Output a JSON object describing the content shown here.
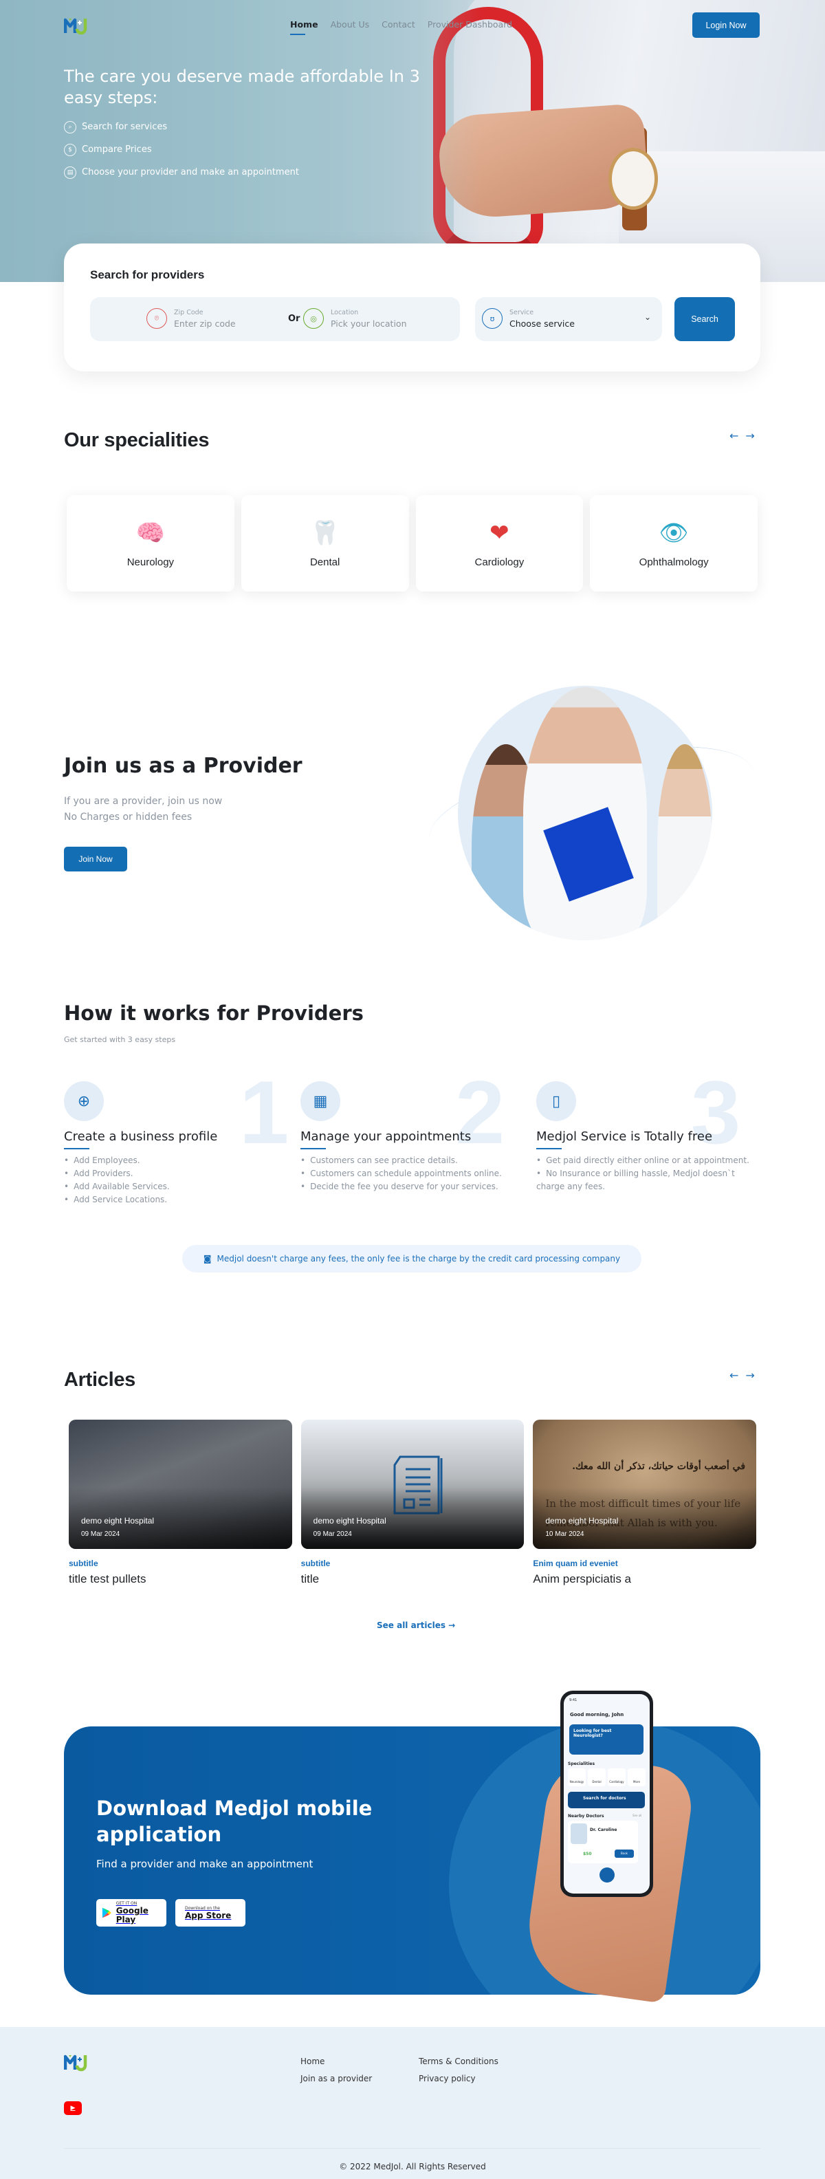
{
  "brand": {
    "logo_text": "M+J",
    "logo_alt": "MedJol logo",
    "accent_color": "#146eb4",
    "logo_blue": "#1a6fba",
    "logo_green": "#8cc63f"
  },
  "nav": {
    "items": [
      {
        "label": "Home",
        "active": true
      },
      {
        "label": "About Us",
        "active": false
      },
      {
        "label": "Contact",
        "active": false
      },
      {
        "label": "Provider Dashboard",
        "active": false
      }
    ],
    "login_label": "Login Now"
  },
  "hero": {
    "title": "The care you deserve made affordable In 3 easy steps:",
    "steps": [
      {
        "icon": "search-icon",
        "label": "Search for services"
      },
      {
        "icon": "dollar-icon",
        "label": "Compare Prices"
      },
      {
        "icon": "calendar-icon",
        "label": "Choose your provider and make an appointment"
      }
    ]
  },
  "search": {
    "title": "Search for providers",
    "zip": {
      "label": "Zip Code",
      "placeholder": "Enter zip code"
    },
    "or_label": "Or",
    "location": {
      "label": "Location",
      "placeholder": "Pick your location"
    },
    "service": {
      "label": "Service",
      "selected": "Choose service"
    },
    "button_label": "Search"
  },
  "specialities": {
    "title": "Our specialities",
    "items": [
      {
        "name": "Neurology",
        "icon": "brain-icon",
        "glyph": "🧠"
      },
      {
        "name": "Dental",
        "icon": "tooth-icon",
        "glyph": "🦷"
      },
      {
        "name": "Cardiology",
        "icon": "heart-organ-icon",
        "glyph": "❤"
      },
      {
        "name": "Ophthalmology",
        "icon": "eye-icon",
        "glyph": "👁"
      }
    ]
  },
  "provider": {
    "title": "Join us as a Provider",
    "line1": "If you are a provider, join us now",
    "line2": "No Charges or hidden fees",
    "button_label": "Join Now"
  },
  "how": {
    "title": "How it works for Providers",
    "subtitle": "Get started with 3 easy steps",
    "steps": [
      {
        "number": "1",
        "icon": "profile-search-icon",
        "title": "Create a business profile",
        "bullets": [
          "Add Employees.",
          "Add Providers.",
          "Add Available Services.",
          "Add Service Locations."
        ]
      },
      {
        "number": "2",
        "icon": "appointments-icon",
        "title": "Manage your appointments",
        "bullets": [
          "Customers can see practice details.",
          "Customers can schedule appointments online.",
          "Decide the fee you deserve for your services."
        ]
      },
      {
        "number": "3",
        "icon": "mobile-check-icon",
        "title": "Medjol Service is Totally free",
        "bullets": [
          "Get paid directly either online or at appointment.",
          "No Insurance or billing hassle, Medjol doesn`t charge any fees."
        ]
      }
    ],
    "notice": "Medjol doesn't charge any fees, the only fee is the charge by the credit card processing company"
  },
  "articles": {
    "title": "Articles",
    "items": [
      {
        "hospital": "demo eight Hospital",
        "date": "09 Mar 2024",
        "subtitle": "subtitle",
        "title": "title test pullets",
        "image": "car-photo"
      },
      {
        "hospital": "demo eight Hospital",
        "date": "09 Mar 2024",
        "subtitle": "subtitle",
        "title": "title",
        "image": "document-icon"
      },
      {
        "hospital": "demo eight Hospital",
        "date": "10 Mar 2024",
        "subtitle": "Enim quam id eveniet",
        "title": "Anim perspiciatis a",
        "image": "quote-photo",
        "image_text_ar": "في أصعب أوقات حياتك، تذكر أن الله معك.",
        "image_text_en": "In the most difficult times of your life remember that Allah is with you."
      }
    ],
    "see_all_label": "See all articles"
  },
  "app": {
    "title": "Download Medjol mobile application",
    "subtitle": "Find a provider and make an appointment",
    "google": {
      "small": "GET IT ON",
      "big": "Google Play"
    },
    "apple": {
      "small": "Download on the",
      "big": "App Store"
    },
    "phone": {
      "time": "9:41",
      "greeting": "Good morning, John",
      "promo": "Looking for best Neurologist?",
      "specialities_label": "Specialities",
      "spec_items": [
        "Neurology",
        "Dental",
        "Cardiology",
        "More"
      ],
      "search_label": "Search for doctors",
      "nearby_label": "Nearby Doctors",
      "see_all": "See all",
      "doctor_name": "Dr. Caroline",
      "price": "$50",
      "book": "Book"
    }
  },
  "footer": {
    "col1": [
      "Home",
      "Join as a provider"
    ],
    "col2": [
      "Terms & Conditions",
      "Privacy policy"
    ],
    "copyright": "© 2022 MedJol. All Rights Reserved"
  }
}
